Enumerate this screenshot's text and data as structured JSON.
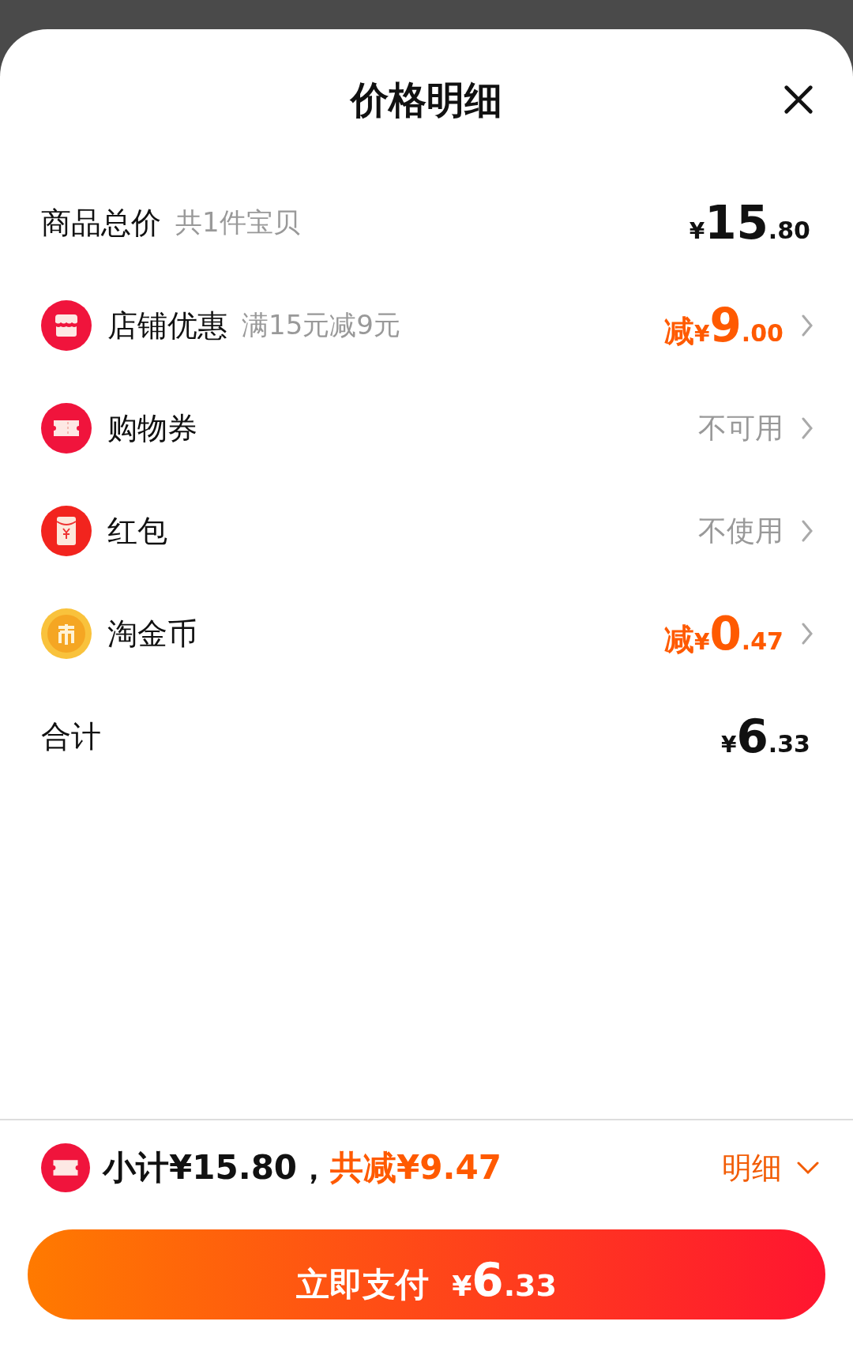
{
  "sheet": {
    "title": "价格明细"
  },
  "product_total": {
    "label": "商品总价",
    "note": "共1件宝贝",
    "price": {
      "currency": "¥",
      "int": "15",
      "dec": ".80"
    }
  },
  "discounts": [
    {
      "kind": "store",
      "label": "店铺优惠",
      "note": "满15元减9元",
      "price": {
        "prefix": "减",
        "currency": "¥",
        "int": "9",
        "dec": ".00"
      }
    },
    {
      "kind": "ticket",
      "label": "购物券",
      "value": "不可用"
    },
    {
      "kind": "envelope",
      "label": "红包",
      "value": "不使用"
    },
    {
      "kind": "coin",
      "label": "淘金币",
      "price": {
        "prefix": "减",
        "currency": "¥",
        "int": "0",
        "dec": ".47"
      }
    }
  ],
  "total": {
    "label": "合计",
    "price": {
      "currency": "¥",
      "int": "6",
      "dec": ".33"
    }
  },
  "footer": {
    "subtotal": "小计¥15.80，",
    "saved": "共减¥9.47",
    "details_link": "明细",
    "pay_button": {
      "label": "立即支付",
      "currency": "¥",
      "int": "6",
      "dec": ".33"
    }
  }
}
